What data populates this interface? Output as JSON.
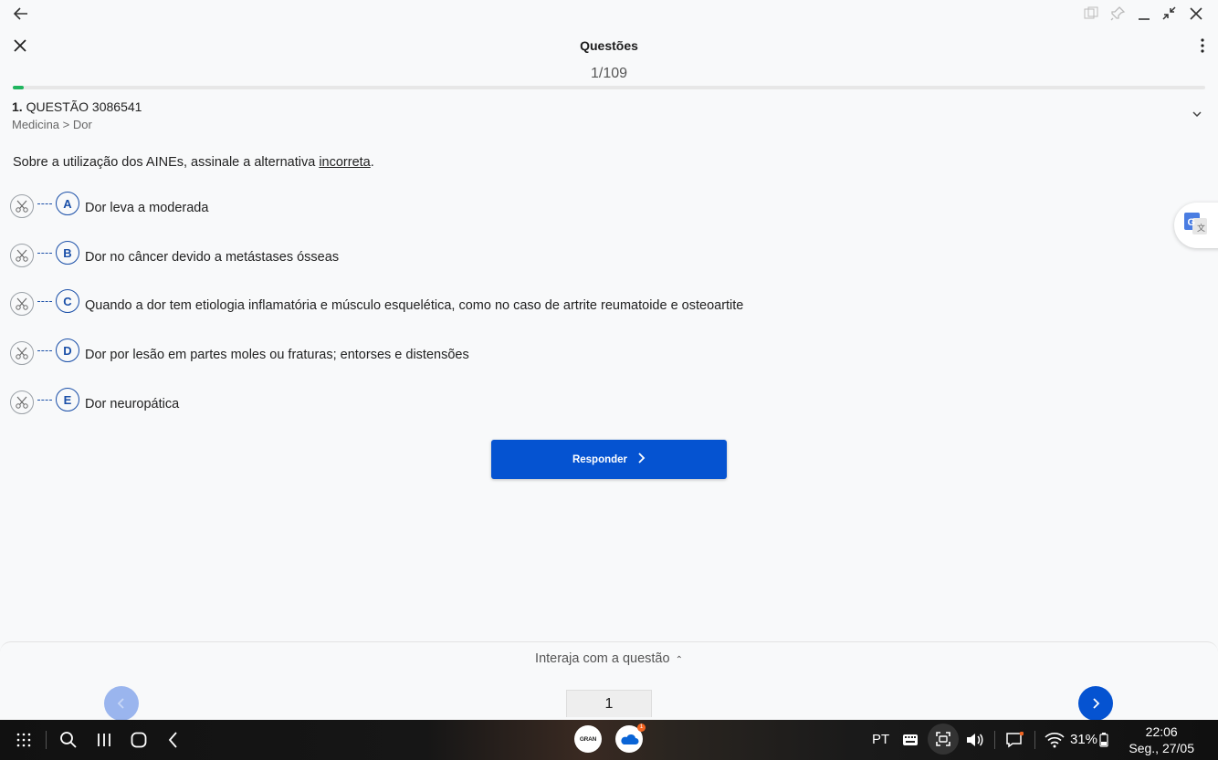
{
  "header": {
    "title": "Questões",
    "counter": "1/109",
    "progress": 0.0092
  },
  "question": {
    "number": "1.",
    "label": "QUESTÃO 3086541",
    "breadcrumb": "Medicina > Dor",
    "text_before": "Sobre a utilização dos AINEs, assinale a alternativa ",
    "text_emphasis": "incorreta",
    "text_after": "."
  },
  "alternatives": [
    {
      "letter": "A",
      "text": "Dor leva a moderada"
    },
    {
      "letter": "B",
      "text": "Dor no câncer devido a metástases ósseas"
    },
    {
      "letter": "C",
      "text": "Quando a dor tem etiologia inflamatória e músculo esquelética, como no caso de artrite reumatoide e osteoartite"
    },
    {
      "letter": "D",
      "text": "Dor por lesão em partes moles ou fraturas; entorses e distensões"
    },
    {
      "letter": "E",
      "text": "Dor neuropática"
    }
  ],
  "actions": {
    "responder_label": "Responder"
  },
  "bottom": {
    "interaja_label": "Interaja com a questão",
    "page_value": "1"
  },
  "taskbar": {
    "language": "PT",
    "battery": "31%",
    "time": "22:06",
    "date": "Seg., 27/05",
    "gran_label": "GRAN",
    "onedrive_badge": "1"
  },
  "colors": {
    "primary": "#0553d1",
    "progress": "#20b55f",
    "letter": "#1a4fa8"
  }
}
